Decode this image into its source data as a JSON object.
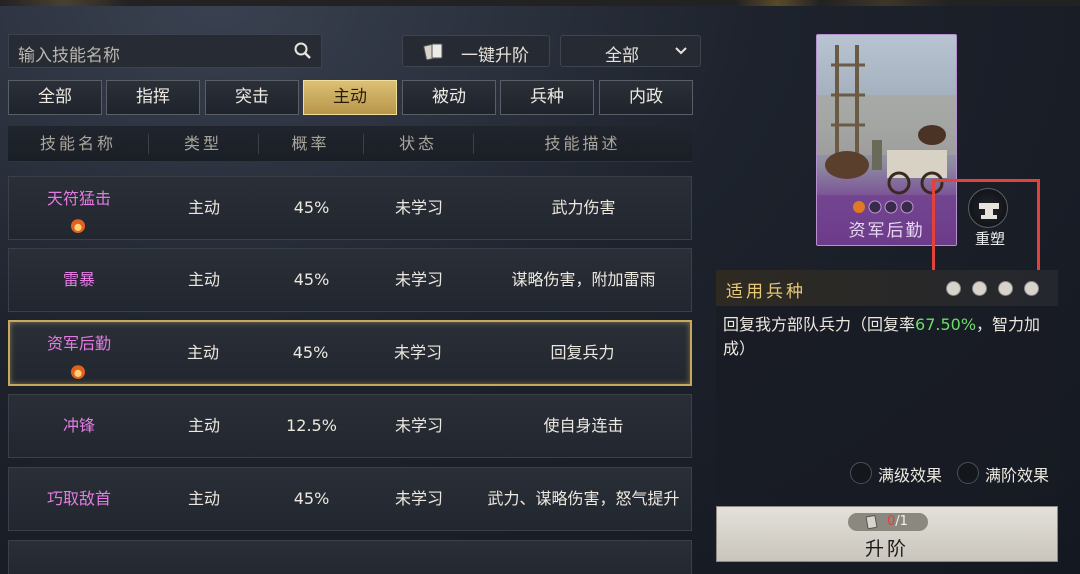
{
  "search": {
    "placeholder": "输入技能名称",
    "icon": "search-icon"
  },
  "toolbar": {
    "upgrade_all_label": "一键升阶",
    "filter_value": "全部"
  },
  "tabs": [
    {
      "label": "全部",
      "active": false
    },
    {
      "label": "指挥",
      "active": false
    },
    {
      "label": "突击",
      "active": false
    },
    {
      "label": "主动",
      "active": true
    },
    {
      "label": "被动",
      "active": false
    },
    {
      "label": "兵种",
      "active": false
    },
    {
      "label": "内政",
      "active": false
    }
  ],
  "table": {
    "headers": [
      "技能名称",
      "类型",
      "概率",
      "状态",
      "技能描述"
    ],
    "rows": [
      {
        "name": "天符猛击",
        "type": "主动",
        "rate": "45%",
        "status": "未学习",
        "desc": "武力伤害",
        "badge": true,
        "selected": false
      },
      {
        "name": "雷暴",
        "type": "主动",
        "rate": "45%",
        "status": "未学习",
        "desc": "谋略伤害，附加雷雨",
        "badge": false,
        "selected": false
      },
      {
        "name": "资军后勤",
        "type": "主动",
        "rate": "45%",
        "status": "未学习",
        "desc": "回复兵力",
        "badge": true,
        "selected": true
      },
      {
        "name": "冲锋",
        "type": "主动",
        "rate": "12.5%",
        "status": "未学习",
        "desc": "使自身连击",
        "badge": false,
        "selected": false
      },
      {
        "name": "巧取敌首",
        "type": "主动",
        "rate": "45%",
        "status": "未学习",
        "desc": "武力、谋略伤害，怒气提升",
        "badge": false,
        "selected": false
      }
    ]
  },
  "detail": {
    "card_name": "资军后勤",
    "rebuild_label": "重塑",
    "troop_title": "适用兵种",
    "desc_before": "回复我方部队兵力（回复率",
    "desc_highlight": "67.50%",
    "desc_after": "，智力加成）",
    "max_level_label": "满级效果",
    "max_rank_label": "满阶效果",
    "cost_have": "0",
    "cost_need": "/1",
    "upgrade_label": "升阶"
  },
  "colors": {
    "accent_gold": "#dcc075",
    "skill_name": "#e37be3",
    "highlight_green": "#6fdc6a",
    "annotation_red": "#e2423a"
  }
}
